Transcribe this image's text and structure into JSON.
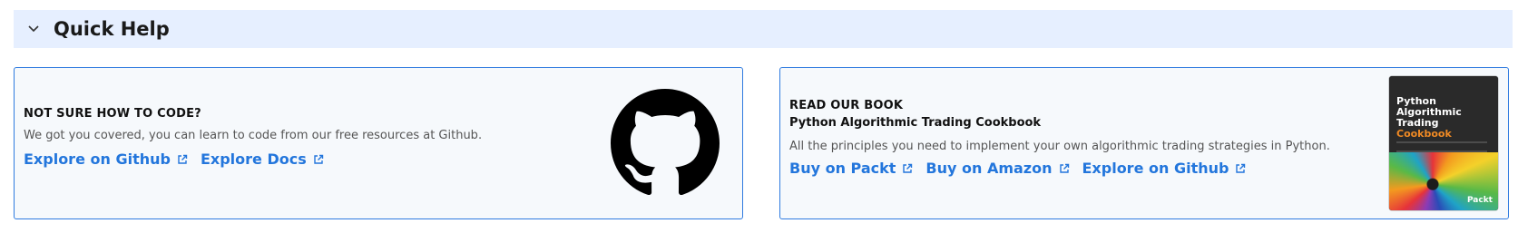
{
  "quick_help": {
    "title": "Quick Help",
    "chevron_icon": "chevron-down-icon"
  },
  "code_card": {
    "eyebrow": "NOT SURE HOW TO CODE?",
    "description": "We got you covered, you can learn to code from our free resources at Github.",
    "links": [
      {
        "label": "Explore on Github",
        "icon": "external-link-icon"
      },
      {
        "label": "Explore Docs",
        "icon": "external-link-icon"
      }
    ],
    "logo": "github-logo-icon"
  },
  "book_card": {
    "eyebrow": "READ OUR BOOK",
    "title": "Python Algorithmic Trading Cookbook",
    "description": "All the principles you need to implement your own algorithmic trading strategies in Python.",
    "links": [
      {
        "label": "Buy on Packt",
        "icon": "external-link-icon"
      },
      {
        "label": "Buy on Amazon",
        "icon": "external-link-icon"
      },
      {
        "label": "Explore on Github",
        "icon": "external-link-icon"
      }
    ],
    "cover": {
      "title_line": "Python Algorithmic Trading",
      "subtitle_line": "Cookbook",
      "publisher": "Packt"
    }
  },
  "colors": {
    "link": "#2376dc",
    "card_border": "#2f7be0",
    "header_bg": "#e6efff",
    "card_bg": "#f6f9fc"
  }
}
